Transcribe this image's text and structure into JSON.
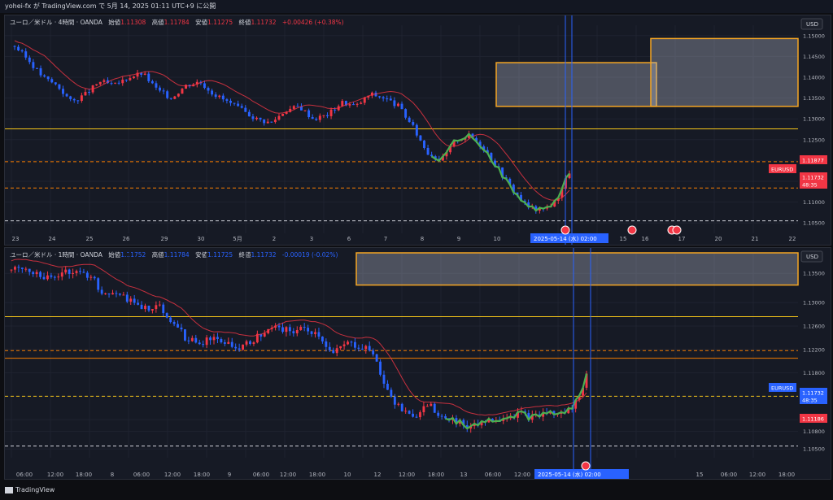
{
  "header": {
    "publish_text": "yohei-fx が TradingView.com で 5月 14, 2025 01:11 UTC+9 に公開"
  },
  "footer": {
    "brand": "TradingView"
  },
  "charts": [
    {
      "legend": {
        "pair": "ユーロ／米ドル · 4時間 · OANDA",
        "open_label": "始値",
        "open": "1.11308",
        "high_label": "高値",
        "high": "1.11784",
        "low_label": "安値",
        "low": "1.11275",
        "close_label": "終値",
        "close": "1.11732",
        "change": "+0.00426 (+0.38%)"
      },
      "currency": "USD",
      "price_ticks": [
        "1.15000",
        "1.14500",
        "1.14000",
        "1.13500",
        "1.13000",
        "1.12500",
        "1.12000",
        "1.11500",
        "1.11000",
        "1.10500"
      ],
      "price_badges": [
        {
          "text": "1.11877",
          "color": "#f23645"
        },
        {
          "text": "EURUSD",
          "color": "#f23645"
        },
        {
          "text": "1.11732",
          "color": "#f23645"
        },
        {
          "text": "48:35",
          "color": "#f23645"
        }
      ],
      "time_ticks": [
        "23",
        "24",
        "25",
        "26",
        "29",
        "30",
        "5月",
        "2",
        "3",
        "6",
        "7",
        "8",
        "9",
        "10",
        "15",
        "16",
        "17",
        "20",
        "21",
        "22"
      ],
      "crosshair_label": "2025-05-14 (水)  02:00",
      "ylim": [
        1.1025,
        1.1525
      ]
    },
    {
      "legend": {
        "pair": "ユーロ／米ドル · 1時間 · OANDA",
        "open_label": "始値",
        "open": "1.11752",
        "high_label": "高値",
        "high": "1.11784",
        "low_label": "安値",
        "low": "1.11725",
        "close_label": "終値",
        "close": "1.11732",
        "change": "-0.00019 (-0.02%)"
      },
      "currency": "USD",
      "price_ticks": [
        "1.13500",
        "1.13000",
        "1.12600",
        "1.12200",
        "1.11800",
        "1.11400",
        "1.11000",
        "1.10800",
        "1.10500"
      ],
      "price_badges": [
        {
          "text": "EURUSD",
          "color": "#2962ff"
        },
        {
          "text": "1.11732",
          "color": "#2962ff"
        },
        {
          "text": "48:35",
          "color": "#2962ff"
        },
        {
          "text": "1.11186",
          "color": "#f23645"
        }
      ],
      "time_ticks": [
        "06:00",
        "12:00",
        "18:00",
        "8",
        "06:00",
        "12:00",
        "18:00",
        "9",
        "06:00",
        "12:00",
        "18:00",
        "10",
        "12",
        "12:00",
        "18:00",
        "13",
        "06:00",
        "12:00",
        "18:00",
        "15",
        "06:00",
        "12:00",
        "18:00"
      ],
      "crosshair_label": "2025-05-14 (水)  02:00",
      "ylim": [
        1.1035,
        1.1385
      ]
    }
  ],
  "chart_data": [
    {
      "type": "candlestick",
      "title": "ユーロ／米ドル · 4時間 · OANDA",
      "ylim": [
        1.1025,
        1.1525
      ],
      "levels": [
        1.1276,
        1.1197,
        1.1134,
        1.1055
      ],
      "zones": [
        [
          1.1435,
          1.133
        ],
        [
          1.1493,
          1.133
        ]
      ],
      "close_path": [
        1.1475,
        1.144,
        1.14,
        1.138,
        1.134,
        1.136,
        1.139,
        1.138,
        1.14,
        1.141,
        1.137,
        1.135,
        1.138,
        1.139,
        1.136,
        1.134,
        1.132,
        1.13,
        1.129,
        1.132,
        1.133,
        1.13,
        1.131,
        1.134,
        1.133,
        1.136,
        1.135,
        1.133,
        1.128,
        1.122,
        1.12,
        1.125,
        1.126,
        1.123,
        1.118,
        1.113,
        1.109,
        1.108,
        1.11,
        1.1173
      ]
    },
    {
      "type": "candlestick",
      "title": "ユーロ／米ドル · 1時間 · OANDA",
      "ylim": [
        1.1035,
        1.1385
      ],
      "levels": [
        1.1276,
        1.1218,
        1.1205,
        1.114,
        1.1055
      ],
      "zones": [
        [
          1.1385,
          1.133
        ]
      ],
      "close_path": [
        1.1355,
        1.136,
        1.135,
        1.134,
        1.1355,
        1.135,
        1.1345,
        1.131,
        1.132,
        1.13,
        1.129,
        1.1295,
        1.127,
        1.124,
        1.123,
        1.124,
        1.1235,
        1.122,
        1.1235,
        1.125,
        1.1258,
        1.125,
        1.1255,
        1.1245,
        1.121,
        1.123,
        1.1225,
        1.122,
        1.115,
        1.112,
        1.11,
        1.113,
        1.111,
        1.11,
        1.109,
        1.1095,
        1.11,
        1.1105,
        1.111,
        1.1102,
        1.1112,
        1.1108,
        1.112,
        1.1173
      ]
    }
  ]
}
